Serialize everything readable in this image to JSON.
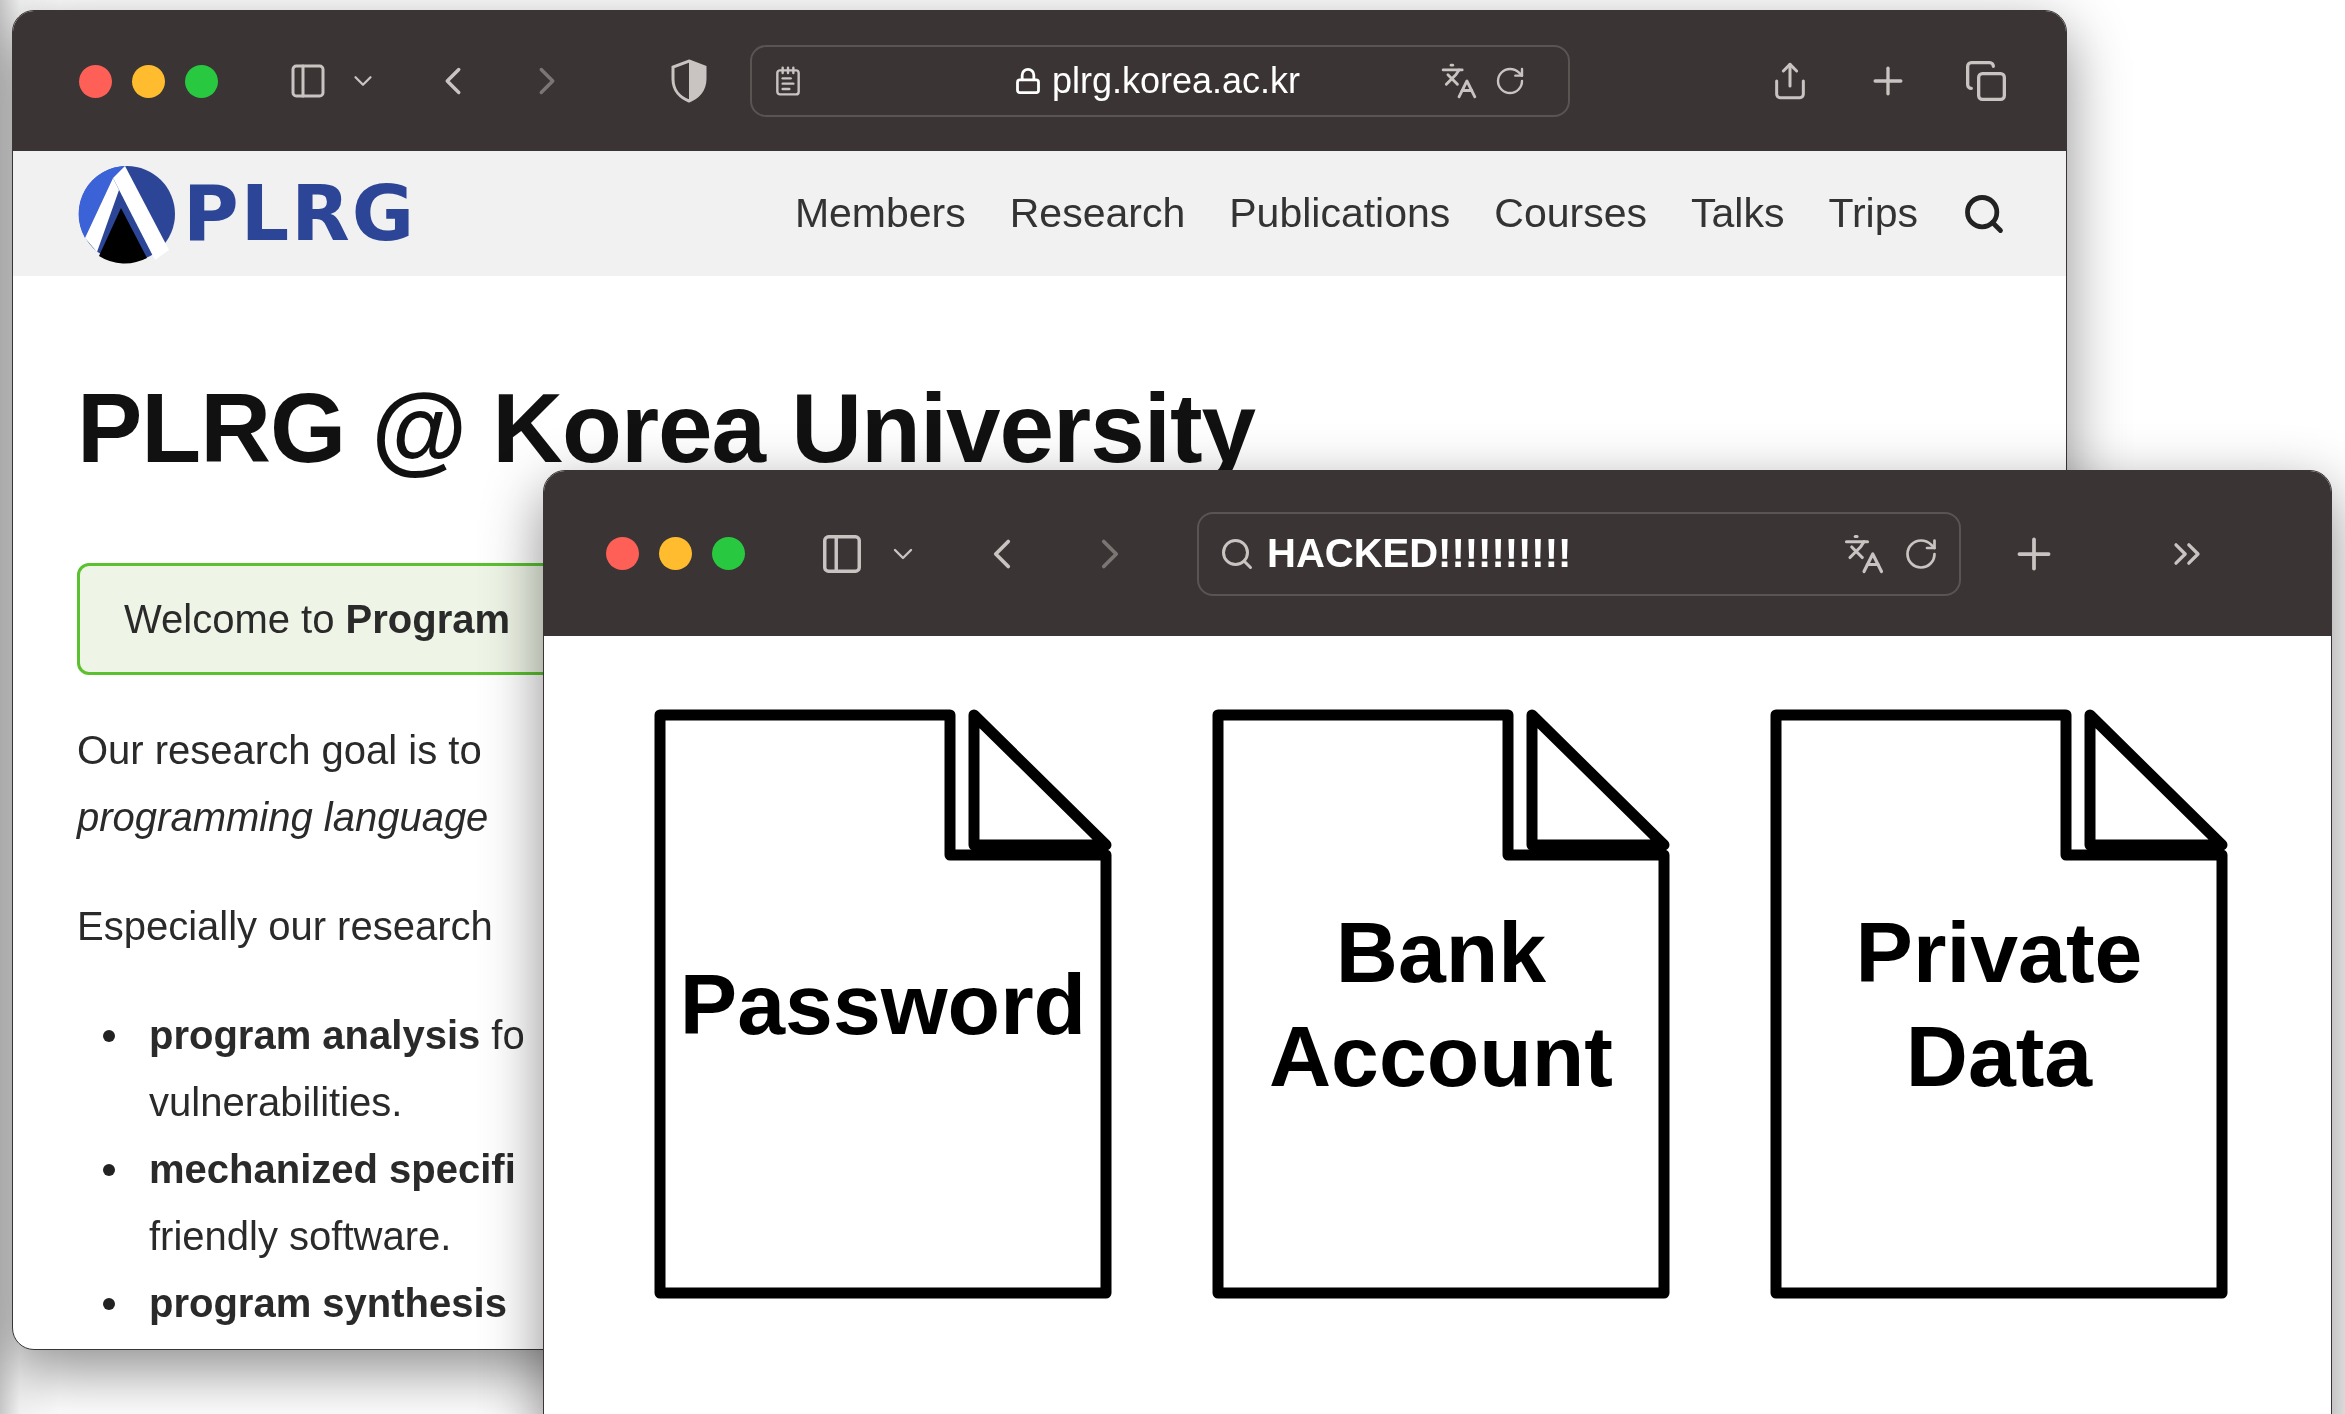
{
  "back_window": {
    "address": "plrg.korea.ac.kr",
    "logo_text": "PLRG",
    "nav": [
      {
        "label": "Members"
      },
      {
        "label": "Research"
      },
      {
        "label": "Publications"
      },
      {
        "label": "Courses"
      },
      {
        "label": "Talks"
      },
      {
        "label": "Trips"
      }
    ],
    "heading": "PLRG @ Korea University",
    "welcome": "Welcome to **Program**",
    "paragraphs": [
      {
        "lines": [
          "Our research goal is to",
          "*programming language*"
        ]
      },
      {
        "lines": [
          "Especially our research"
        ]
      }
    ],
    "bullets": [
      {
        "lines": [
          "**program analysis** fo",
          "vulnerabilities."
        ]
      },
      {
        "lines": [
          "**mechanized specifi**",
          "friendly software."
        ]
      },
      {
        "lines": [
          "**program synthesis**"
        ]
      }
    ]
  },
  "front_window": {
    "search_text": "HACKED!!!!!!!!!!",
    "documents": [
      {
        "label": "Password"
      },
      {
        "label": "Bank Account"
      },
      {
        "label": "Private Data"
      }
    ]
  }
}
